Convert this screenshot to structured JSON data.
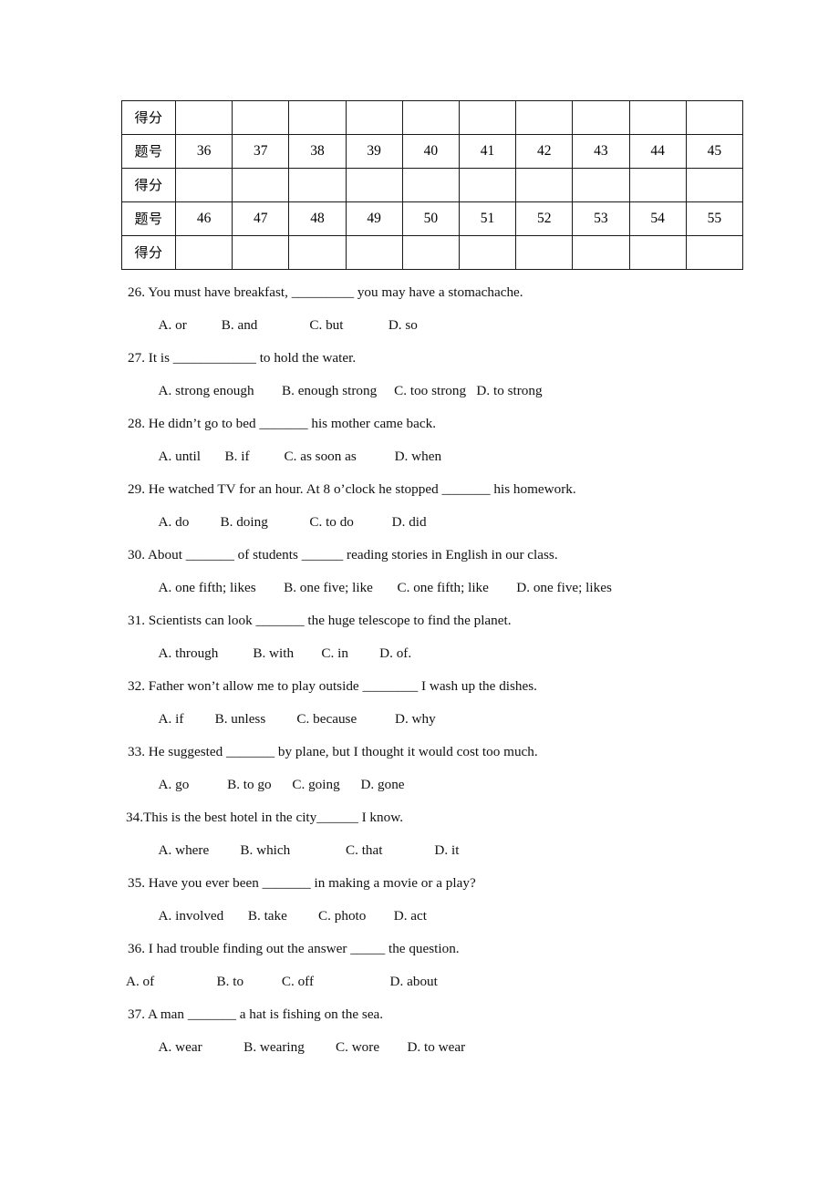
{
  "score_table": {
    "row_label_score": "得分",
    "row_label_number": "题号",
    "rows": [
      {
        "type": "score",
        "label": "得分",
        "cells": [
          "",
          "",
          "",
          "",
          "",
          "",
          "",
          "",
          "",
          ""
        ]
      },
      {
        "type": "number",
        "label": "题号",
        "cells": [
          "36",
          "37",
          "38",
          "39",
          "40",
          "41",
          "42",
          "43",
          "44",
          "45"
        ]
      },
      {
        "type": "score",
        "label": "得分",
        "cells": [
          "",
          "",
          "",
          "",
          "",
          "",
          "",
          "",
          "",
          ""
        ]
      },
      {
        "type": "number",
        "label": "题号",
        "cells": [
          "46",
          "47",
          "48",
          "49",
          "50",
          "51",
          "52",
          "53",
          "54",
          "55"
        ]
      },
      {
        "type": "score",
        "label": "得分",
        "cells": [
          "",
          "",
          "",
          "",
          "",
          "",
          "",
          "",
          "",
          ""
        ]
      }
    ]
  },
  "questions": [
    {
      "stem": "26. You must have breakfast, _________ you may have a stomachache.",
      "options": "   A. or          B. and               C. but             D. so",
      "options_flush": false,
      "stem_tight": false
    },
    {
      "stem": "27. It is ____________ to hold the water.",
      "options": "   A. strong enough        B. enough strong     C. too strong   D. to strong",
      "options_flush": false,
      "stem_tight": false
    },
    {
      "stem": "28. He didn’t go to bed _______ his mother came back.",
      "options": "   A. until       B. if          C. as soon as           D. when",
      "options_flush": false,
      "stem_tight": false
    },
    {
      "stem": "29. He watched TV for an hour. At 8 o’clock he stopped _______ his homework.",
      "options": "   A. do         B. doing            C. to do           D. did",
      "options_flush": false,
      "stem_tight": false
    },
    {
      "stem": "30. About _______ of students ______ reading stories in English in our class.",
      "options": "   A. one fifth; likes        B. one five; like       C. one fifth; like        D. one five; likes",
      "options_flush": false,
      "stem_tight": false
    },
    {
      "stem": "31. Scientists can look _______ the huge telescope to find the planet.",
      "options": "   A. through          B. with        C. in         D. of.",
      "options_flush": false,
      "stem_tight": false
    },
    {
      "stem": "32. Father won’t allow me to play outside ________ I wash up the dishes.",
      "options": "   A. if         B. unless         C. because           D. why",
      "options_flush": false,
      "stem_tight": false
    },
    {
      "stem": "33. He suggested _______ by plane, but I thought it would cost too much.",
      "options": "   A. go           B. to go      C. going      D. gone",
      "options_flush": false,
      "stem_tight": false
    },
    {
      "stem": "34.This is the best hotel in the city______ I know.",
      "options": "   A. where         B. which                C. that               D. it",
      "options_flush": false,
      "stem_tight": true
    },
    {
      "stem": "35. Have you ever been _______ in making a movie or a play?",
      "options": "   A. involved       B. take         C. photo        D. act",
      "options_flush": false,
      "stem_tight": false
    },
    {
      "stem": "36. I had trouble finding out the answer _____ the question.",
      "options": "A. of                  B. to           C. off                      D. about",
      "options_flush": true,
      "stem_tight": false
    },
    {
      "stem": "37. A man _______ a hat is fishing on the sea.",
      "options": "   A. wear            B. wearing         C. wore        D. to wear",
      "options_flush": false,
      "stem_tight": false
    }
  ]
}
